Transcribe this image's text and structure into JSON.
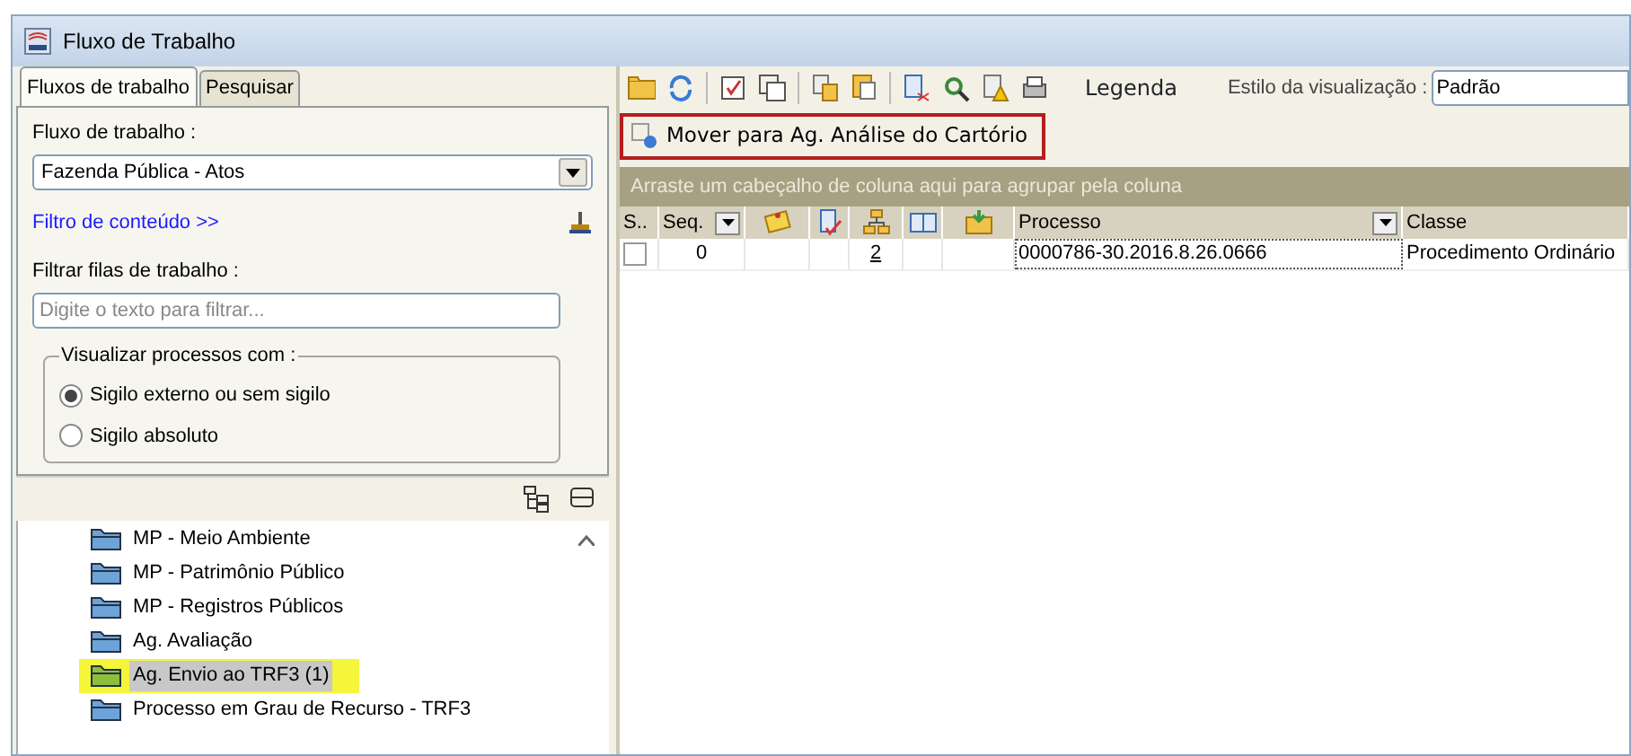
{
  "window": {
    "title": "Fluxo de Trabalho"
  },
  "tabs": [
    {
      "label": "Fluxos de trabalho",
      "selected": true
    },
    {
      "label": "Pesquisar",
      "selected": false
    }
  ],
  "workflow": {
    "label": "Fluxo de trabalho :",
    "value": "Fazenda Pública - Atos"
  },
  "content_filter": {
    "link": "Filtro de conteúdo >>"
  },
  "queue_filter": {
    "label": "Filtrar filas de trabalho :",
    "placeholder": "Digite o texto para filtrar..."
  },
  "visibility": {
    "legend": "Visualizar processos com :",
    "options": [
      {
        "label": "Sigilo externo ou sem sigilo",
        "selected": true
      },
      {
        "label": "Sigilo absoluto",
        "selected": false
      }
    ]
  },
  "tree": [
    {
      "label": "MP - Meio Ambiente",
      "selected": false,
      "highlighted": false
    },
    {
      "label": "MP - Patrimônio Público",
      "selected": false,
      "highlighted": false
    },
    {
      "label": "MP - Registros Públicos",
      "selected": false,
      "highlighted": false
    },
    {
      "label": "Ag. Avaliação",
      "selected": false,
      "highlighted": false
    },
    {
      "label": "Ag. Envio ao TRF3 (1)",
      "selected": true,
      "highlighted": true
    },
    {
      "label": "Processo em Grau de Recurso - TRF3",
      "selected": false,
      "highlighted": false
    }
  ],
  "toolbar": {
    "legend": "Legenda",
    "view_style_label": "Estilo da visualização :",
    "view_style": "Padrão"
  },
  "action": {
    "label": "Mover para Ag. Análise do Cartório",
    "outlined": true
  },
  "group_hint": "Arraste um cabeçalho de coluna aqui para agrupar pela coluna",
  "table": {
    "columns": [
      {
        "kind": "text",
        "label": "S.."
      },
      {
        "kind": "filter",
        "label": "Seq."
      },
      {
        "kind": "icon"
      },
      {
        "kind": "icon"
      },
      {
        "kind": "icon"
      },
      {
        "kind": "icon"
      },
      {
        "kind": "icon"
      },
      {
        "kind": "filter",
        "label": "Processo"
      },
      {
        "kind": "text",
        "label": "Classe"
      }
    ],
    "rows": [
      {
        "checked": false,
        "seq": "0",
        "column_5": "2",
        "processo": "0000786-30.2016.8.26.0666",
        "classe": "Procedimento Ordinário"
      }
    ]
  }
}
